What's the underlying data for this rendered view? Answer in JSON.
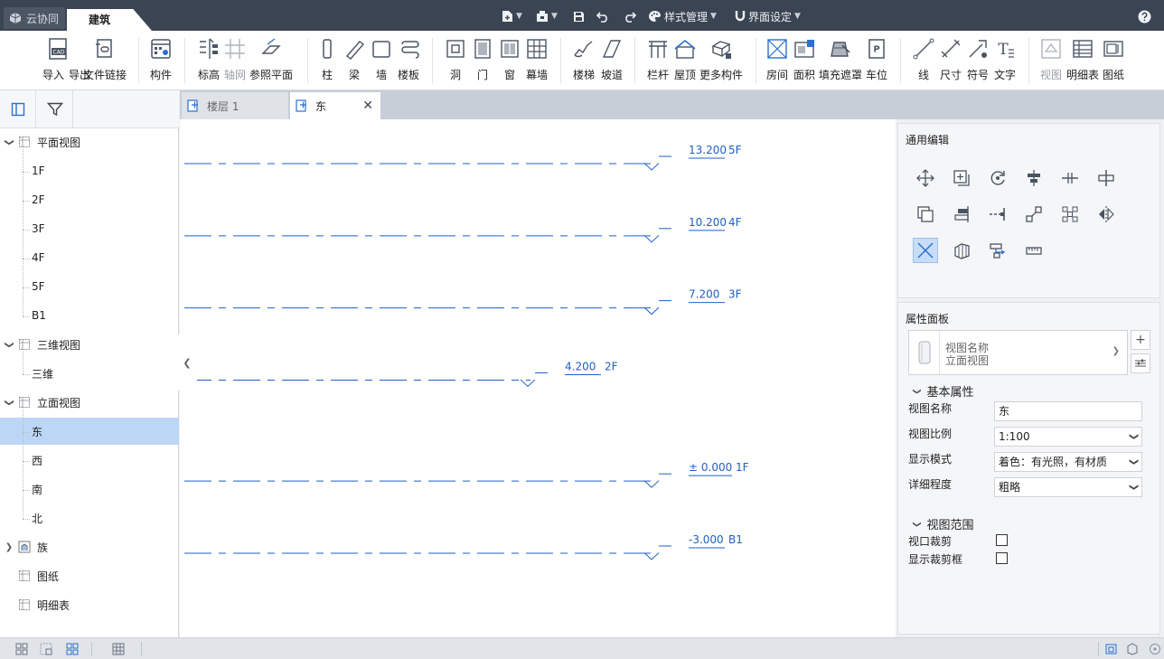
{
  "colors": {
    "titlebar": "#3b4452",
    "selection": "#bcd6f5",
    "level_line": "#1f5fc4",
    "accent": "#2b6fd1"
  },
  "titlebar": {
    "logo_label": "云协同",
    "active_tab": "建筑",
    "style_manager": "样式管理",
    "ui_settings": "界面设定",
    "help_icon": "help-icon"
  },
  "ribbon": {
    "tools": [
      {
        "id": "import-cad",
        "label": "导入",
        "icon": "cad-import-icon"
      },
      {
        "id": "export",
        "label": "导出",
        "icon": "export-icon"
      },
      {
        "id": "file-link",
        "label": "文件链接",
        "icon": "file-link-icon"
      },
      {
        "id": "component",
        "label": "构件",
        "icon": "component-icon"
      },
      {
        "id": "elevation",
        "label": "标高",
        "icon": "elevation-icon"
      },
      {
        "id": "grid",
        "label": "轴网",
        "icon": "grid-icon",
        "disabled": true
      },
      {
        "id": "ref-plane",
        "label": "参照平面",
        "icon": "ref-plane-icon"
      },
      {
        "id": "column",
        "label": "柱",
        "icon": "column-icon"
      },
      {
        "id": "beam",
        "label": "梁",
        "icon": "beam-icon"
      },
      {
        "id": "wall",
        "label": "墙",
        "icon": "wall-icon"
      },
      {
        "id": "slab",
        "label": "楼板",
        "icon": "slab-icon"
      },
      {
        "id": "opening",
        "label": "洞",
        "icon": "opening-icon"
      },
      {
        "id": "door",
        "label": "门",
        "icon": "door-icon"
      },
      {
        "id": "window",
        "label": "窗",
        "icon": "window-icon"
      },
      {
        "id": "curtain-wall",
        "label": "幕墙",
        "icon": "curtain-wall-icon"
      },
      {
        "id": "stair",
        "label": "楼梯",
        "icon": "stair-icon"
      },
      {
        "id": "ramp",
        "label": "坡道",
        "icon": "ramp-icon"
      },
      {
        "id": "railing",
        "label": "栏杆",
        "icon": "railing-icon"
      },
      {
        "id": "roof",
        "label": "屋顶",
        "icon": "roof-icon"
      },
      {
        "id": "more-components",
        "label": "更多构件",
        "icon": "more-components-icon"
      },
      {
        "id": "room",
        "label": "房间",
        "icon": "room-icon"
      },
      {
        "id": "area",
        "label": "面积",
        "icon": "area-icon"
      },
      {
        "id": "fill-mask",
        "label": "填充遮罩",
        "icon": "fill-mask-icon"
      },
      {
        "id": "parking",
        "label": "车位",
        "icon": "parking-icon"
      },
      {
        "id": "line",
        "label": "线",
        "icon": "line-icon"
      },
      {
        "id": "dimension",
        "label": "尺寸",
        "icon": "dimension-icon"
      },
      {
        "id": "symbol",
        "label": "符号",
        "icon": "symbol-icon"
      },
      {
        "id": "text",
        "label": "文字",
        "icon": "text-icon"
      },
      {
        "id": "view",
        "label": "视图",
        "icon": "view-icon",
        "disabled": true
      },
      {
        "id": "schedule",
        "label": "明细表",
        "icon": "schedule-icon"
      },
      {
        "id": "sheet",
        "label": "图纸",
        "icon": "sheet-icon"
      }
    ]
  },
  "left_panel": {
    "tool_buttons": [
      "panel-toggle-icon",
      "filter-icon"
    ],
    "tree": [
      {
        "label": "平面视图",
        "level": 0,
        "expanded": true,
        "icon": "plan-view-icon"
      },
      {
        "label": "1F",
        "level": 1
      },
      {
        "label": "2F",
        "level": 1
      },
      {
        "label": "3F",
        "level": 1
      },
      {
        "label": "4F",
        "level": 1
      },
      {
        "label": "5F",
        "level": 1
      },
      {
        "label": "B1",
        "level": 1
      },
      {
        "label": "三维视图",
        "level": 0,
        "expanded": true,
        "icon": "3d-view-icon"
      },
      {
        "label": "三维",
        "level": 1
      },
      {
        "label": "立面视图",
        "level": 0,
        "expanded": true,
        "icon": "elevation-view-icon"
      },
      {
        "label": "东",
        "level": 1,
        "selected": true
      },
      {
        "label": "西",
        "level": 1
      },
      {
        "label": "南",
        "level": 1
      },
      {
        "label": "北",
        "level": 1
      },
      {
        "label": "族",
        "level": 0,
        "expanded": false,
        "icon": "family-icon"
      },
      {
        "label": "图纸",
        "level": 0,
        "icon": "sheet-tree-icon"
      },
      {
        "label": "明细表",
        "level": 0,
        "icon": "schedule-tree-icon"
      }
    ]
  },
  "doc_tabs": [
    {
      "label": "楼层 1",
      "active": false
    },
    {
      "label": "东",
      "active": true,
      "closable": true
    }
  ],
  "levels": [
    {
      "name": "5F",
      "elevation": "13.200",
      "value": 13.2
    },
    {
      "name": "4F",
      "elevation": "10.200",
      "value": 10.2
    },
    {
      "name": "3F",
      "elevation": "7.200",
      "value": 7.2
    },
    {
      "name": "2F",
      "elevation": "4.200",
      "value": 4.2
    },
    {
      "name": "1F",
      "elevation": "± 0.000",
      "value": 0.0
    },
    {
      "name": "B1",
      "elevation": "-3.000",
      "value": -3.0
    }
  ],
  "edit_panel": {
    "title": "通用编辑",
    "tools": [
      "move-icon",
      "copy-icon",
      "rotate-icon",
      "align-icon",
      "split-icon",
      "trim-icon",
      "offset-icon",
      "align-right-icon",
      "extend-icon",
      "array-icon",
      "array-grid-icon",
      "mirror-icon",
      "delete-icon",
      "create-group-icon",
      "pin-icon",
      "measure-icon"
    ],
    "active_tool": "delete-icon"
  },
  "property_panel": {
    "title": "属性面板",
    "type_label": "视图名称",
    "type_value": "立面视图",
    "add_icon": "add-icon",
    "settings_icon": "type-settings-icon",
    "sections": [
      {
        "title": "基本属性",
        "props": [
          {
            "label": "视图名称",
            "value": "东",
            "kind": "text"
          },
          {
            "label": "视图比例",
            "value": "1:100",
            "kind": "select"
          },
          {
            "label": "显示模式",
            "value": "着色：有光照，有材质",
            "kind": "select"
          },
          {
            "label": "详细程度",
            "value": "粗略",
            "kind": "select"
          }
        ]
      },
      {
        "title": "视图范围",
        "props": [
          {
            "label": "视口裁剪",
            "checked": false,
            "kind": "checkbox"
          },
          {
            "label": "显示裁剪框",
            "checked": false,
            "kind": "checkbox"
          }
        ]
      }
    ]
  },
  "status_bar": {
    "icons": [
      "layout-grid-icon",
      "layout-split-icon",
      "layout-tile-icon",
      "sheet-grid-icon",
      "view-cube-icon",
      "box-view-icon",
      "info-icon"
    ]
  }
}
